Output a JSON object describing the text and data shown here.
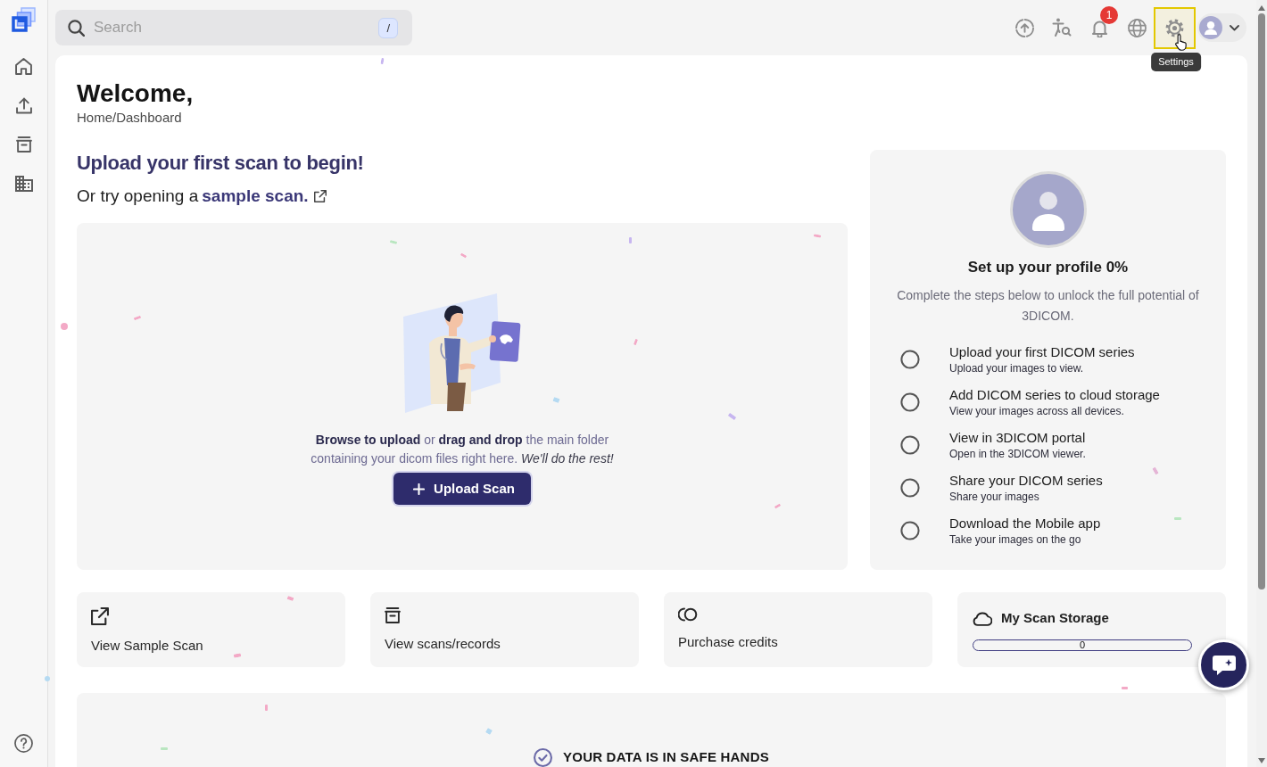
{
  "topbar": {
    "search": {
      "placeholder": "Search",
      "shortcut": "/"
    },
    "tools": [
      {
        "kind": "upload",
        "highlighted": false
      },
      {
        "kind": "accessibility",
        "highlighted": false
      },
      {
        "kind": "notifications",
        "highlighted": false,
        "badge": "1"
      },
      {
        "kind": "language",
        "highlighted": false
      },
      {
        "kind": "settings",
        "highlighted": true,
        "tooltip": "Settings"
      }
    ]
  },
  "header": {
    "title": "Welcome,",
    "breadcrumb": "Home/Dashboard"
  },
  "upload": {
    "heading": "Upload your first scan to begin!",
    "sample_prompt": "Or try opening a",
    "sample_link": "sample scan.",
    "drop_text": "**Browse to upload** or **drag and drop** the main folder containing your dicom files right here. *We'll do the rest!*",
    "button": "Upload Scan"
  },
  "profile": {
    "heading": "Set up your profile 0%",
    "description": "Complete the steps below to unlock the full potential of 3DICOM.",
    "steps": [
      {
        "title": "Upload your first DICOM series",
        "subtitle": "Upload your images to view.",
        "checked": false
      },
      {
        "title": "Add DICOM series to cloud storage",
        "subtitle": "View your images across all devices.",
        "checked": false
      },
      {
        "title": "View in 3DICOM portal",
        "subtitle": "Open in the 3DICOM viewer.",
        "checked": false
      },
      {
        "title": "Share your DICOM series",
        "subtitle": "Share your images",
        "checked": false
      },
      {
        "title": "Download the Mobile app",
        "subtitle": "Take your images on the go",
        "checked": false
      }
    ]
  },
  "shortcuts": [
    {
      "kind": "link",
      "label": "View Sample Scan"
    },
    {
      "kind": "link",
      "label": "View scans/records"
    },
    {
      "kind": "link",
      "label": "Purchase credits"
    },
    {
      "kind": "storage",
      "label": "My Scan Storage",
      "reading": "0"
    }
  ],
  "security": {
    "heading": "YOUR DATA IS IN SAFE HANDS"
  }
}
